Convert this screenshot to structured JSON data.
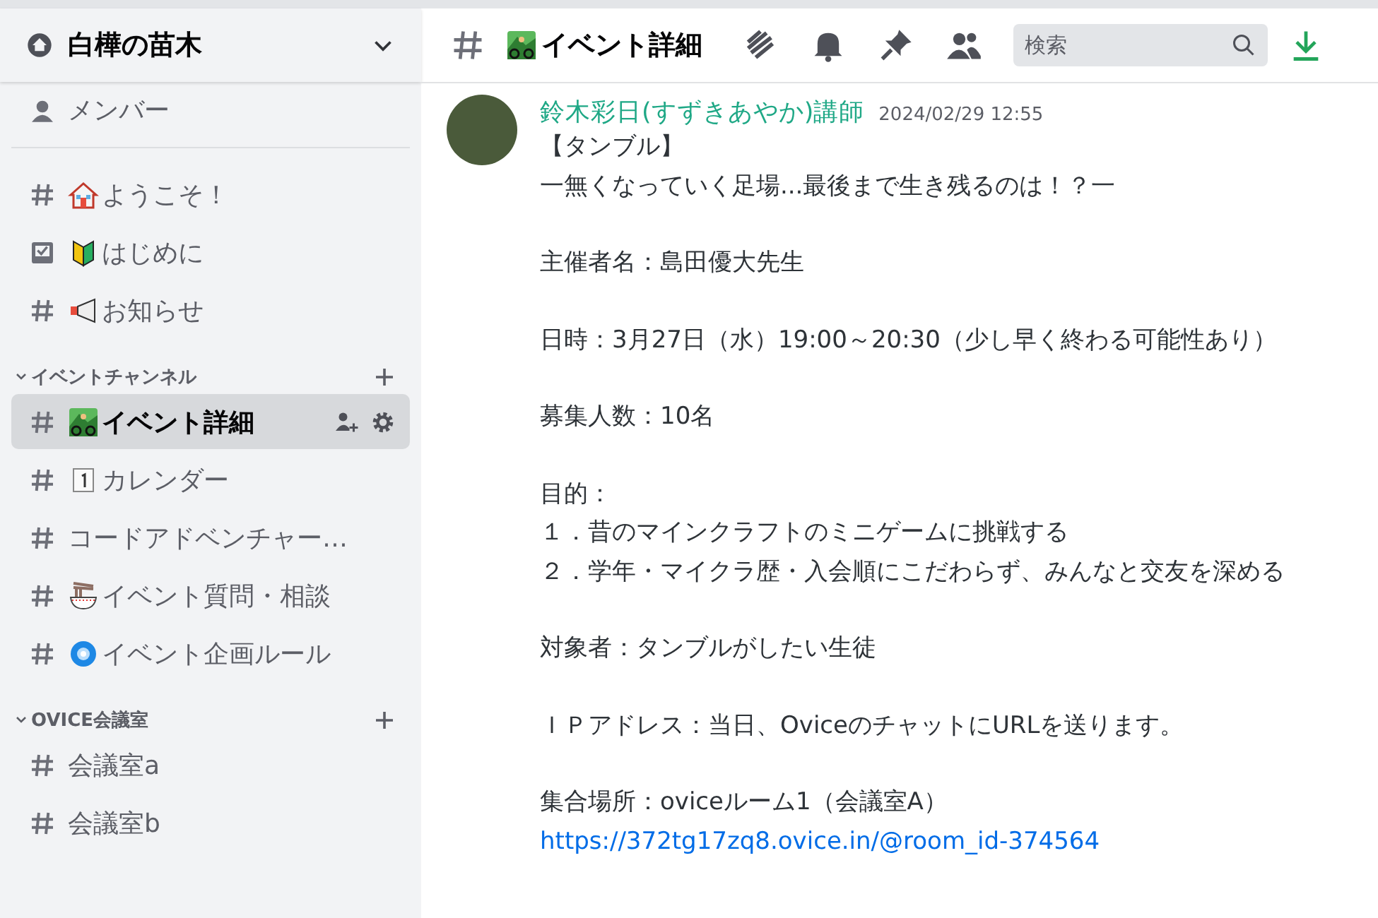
{
  "server": {
    "name": "白樺の苗木"
  },
  "sidebar": {
    "top_items": [
      {
        "label": "メンバー",
        "kind": "members"
      }
    ],
    "channels": [
      {
        "label": "ようこそ！",
        "kind": "text",
        "emoji": {
          "kind": "house"
        },
        "selected": false
      },
      {
        "label": "はじめに",
        "kind": "rules",
        "emoji": {
          "kind": "beginner"
        },
        "selected": false
      },
      {
        "label": "お知らせ",
        "kind": "text",
        "emoji": {
          "kind": "megaphone"
        },
        "selected": false
      }
    ],
    "categories": [
      {
        "name": "イベントチャンネル",
        "channels": [
          {
            "label": "イベント詳細",
            "kind": "text",
            "emoji": {
              "kind": "biker"
            },
            "selected": true
          },
          {
            "label": "カレンダー",
            "kind": "text",
            "emoji": {
              "kind": "calendar"
            },
            "selected": false
          },
          {
            "label": "コードアドベンチャー…",
            "kind": "text",
            "selected": false
          },
          {
            "label": "イベント質問・相談",
            "kind": "text",
            "emoji": {
              "kind": "ramen"
            },
            "selected": false
          },
          {
            "label": "イベント企画ルール",
            "kind": "text",
            "emoji": {
              "kind": "cyclone"
            },
            "selected": false
          }
        ]
      },
      {
        "name": "OVICE会議室",
        "channels": [
          {
            "label": "会議室a",
            "kind": "text",
            "selected": false
          },
          {
            "label": "会議室b",
            "kind": "text",
            "selected": false
          }
        ]
      }
    ]
  },
  "header": {
    "channel": "イベント詳細",
    "emoji": {
      "kind": "biker"
    },
    "search": {
      "placeholder": "検索"
    }
  },
  "message": {
    "author": "鈴木彩日(すずきあやか)講師",
    "timestamp": "2024/02/29 12:55",
    "blocks": [
      [
        {
          "kind": "text",
          "text": "【タンブル】"
        },
        {
          "kind": "text",
          "text": "一無くなっていく足場...最後まで生き残るのは！？一"
        }
      ],
      [
        {
          "kind": "text",
          "text": "主催者名：島田優大先生"
        }
      ],
      [
        {
          "kind": "text",
          "text": "日時：3月27日（水）19:00～20:30（少し早く終わる可能性あり）"
        }
      ],
      [
        {
          "kind": "text",
          "text": "募集人数：10名"
        }
      ],
      [
        {
          "kind": "text",
          "text": "目的："
        },
        {
          "kind": "text",
          "text": "１．昔のマインクラフトのミニゲームに挑戦する"
        },
        {
          "kind": "text",
          "text": "２．学年・マイクラ歴・入会順にこだわらず、みんなと交友を深める"
        }
      ],
      [
        {
          "kind": "text",
          "text": "対象者：タンブルがしたい生徒"
        }
      ],
      [
        {
          "kind": "text",
          "text": "ＩＰアドレス：当日、OviceのチャットにURLを送ります。"
        }
      ],
      [
        {
          "kind": "text",
          "text": "集合場所：oviceルーム1（会議室A）"
        },
        {
          "kind": "link",
          "text": "https://372tg17zq8.ovice.in/@room_id-374564"
        }
      ]
    ]
  }
}
